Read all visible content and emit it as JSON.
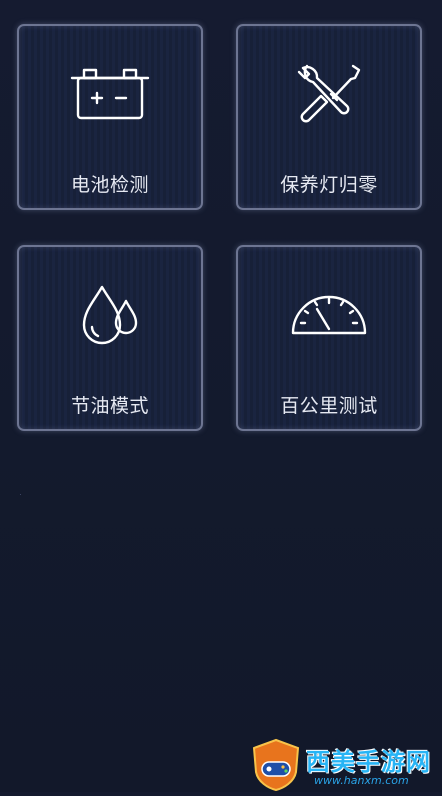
{
  "tiles": [
    {
      "label": "电池检测",
      "icon": "battery-icon"
    },
    {
      "label": "保养灯归零",
      "icon": "wrench-screwdriver-icon"
    },
    {
      "label": "节油模式",
      "icon": "water-drops-icon"
    },
    {
      "label": "百公里测试",
      "icon": "speedometer-icon"
    }
  ],
  "watermark": {
    "title": "西美手游网",
    "url": "www.hanxm.com"
  },
  "colors": {
    "background": "#141a2e",
    "tile_border": "#6d7592",
    "label": "#e6e9f2",
    "watermark_blue": "#27b4f5"
  }
}
